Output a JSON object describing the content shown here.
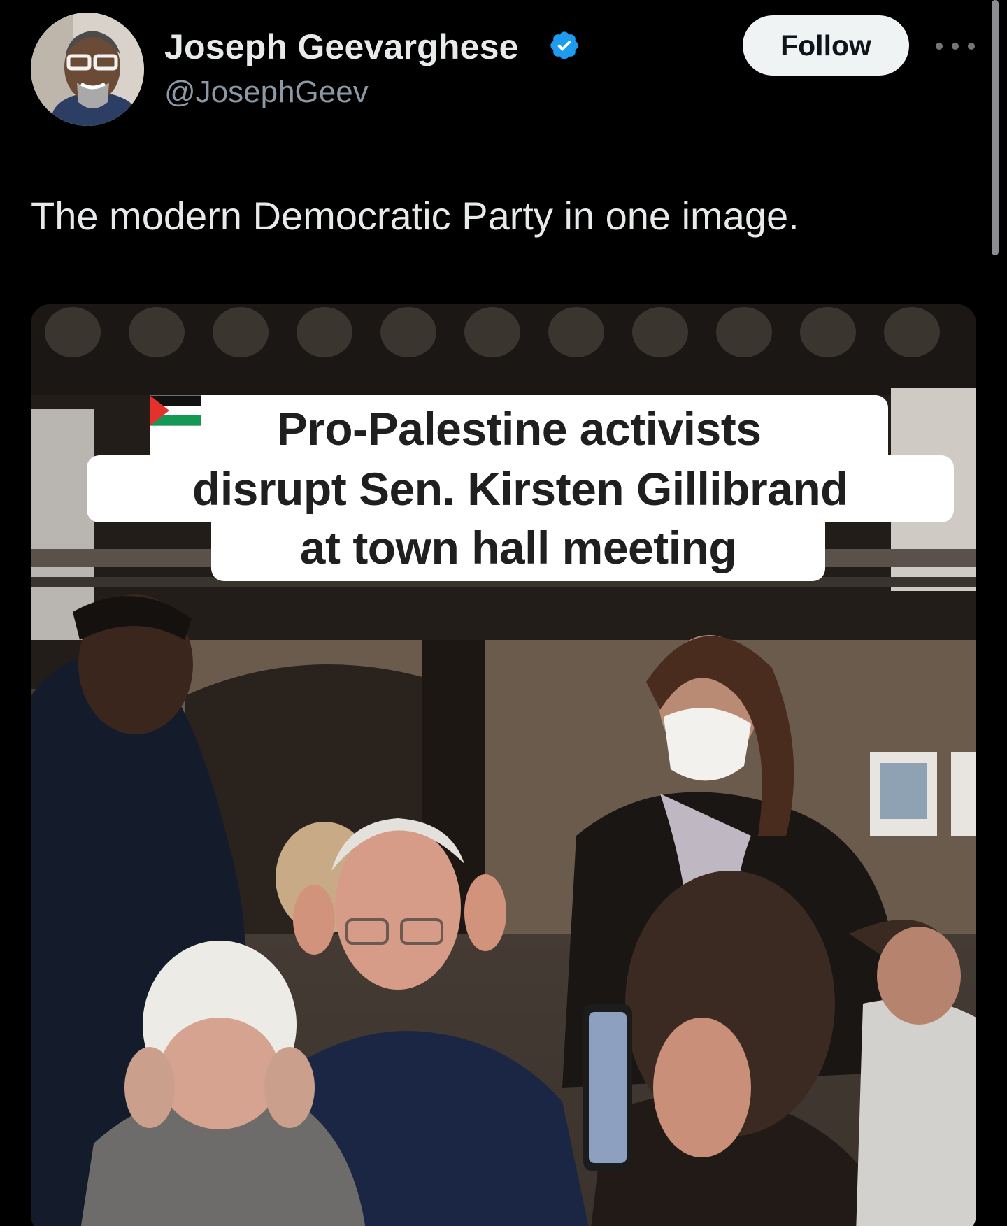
{
  "author": {
    "name": "Joseph Geevarghese",
    "handle": "@JosephGeev",
    "verified": true,
    "verified_color": "#1d9bf0"
  },
  "actions": {
    "follow_label": "Follow",
    "more_icon": "more-horizontal-icon"
  },
  "tweet": {
    "text": "The modern Democratic Party in one image."
  },
  "media": {
    "caption_lines": [
      "Pro-Palestine activists",
      "disrupt Sen. Kirsten Gillibrand",
      "at town hall meeting"
    ],
    "caption_icon": "palestine-flag-icon"
  },
  "colors": {
    "background": "#000000",
    "text_primary": "#e7e9ea",
    "text_secondary": "#8b98a5",
    "follow_bg": "#eff3f4",
    "follow_text": "#0f1419"
  }
}
